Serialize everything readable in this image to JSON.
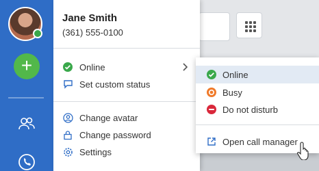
{
  "user": {
    "name": "Jane Smith",
    "phone": "(361) 555-0100"
  },
  "menu": {
    "status_label": "Online",
    "custom_status": "Set custom status",
    "change_avatar": "Change avatar",
    "change_password": "Change password",
    "settings": "Settings"
  },
  "status_submenu": {
    "items": [
      {
        "label": "Online",
        "color": "#3aa84b"
      },
      {
        "label": "Busy",
        "color": "#f07a2a"
      },
      {
        "label": "Do not disturb",
        "color": "#d9283b"
      }
    ],
    "call_manager": "Open call manager"
  },
  "colors": {
    "rail": "#2f6dc6",
    "accent_green": "#52b84a",
    "link_blue": "#2f6dc6"
  }
}
